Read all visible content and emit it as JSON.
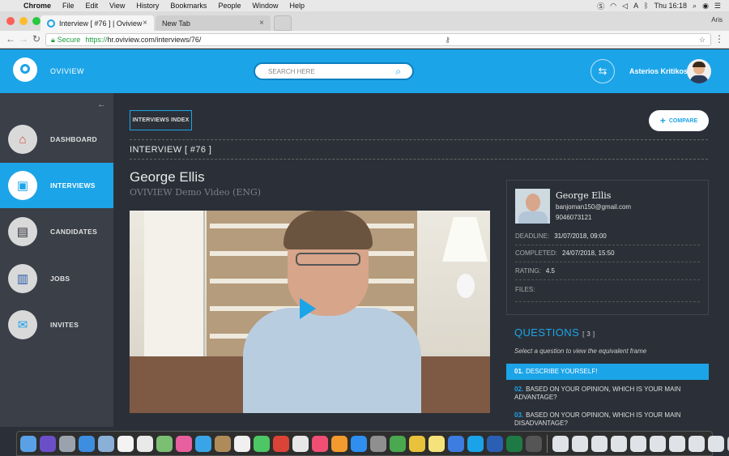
{
  "menubar": {
    "app": "Chrome",
    "items": [
      "File",
      "Edit",
      "View",
      "History",
      "Bookmarks",
      "People",
      "Window",
      "Help"
    ],
    "clock": "Thu 16:18",
    "input_source": "A"
  },
  "browser": {
    "tabs": [
      {
        "label": "Interview [ #76 ] | Oviview"
      },
      {
        "label": "New Tab"
      }
    ],
    "profile": "Aris",
    "secure_label": "Secure",
    "url_scheme": "https://",
    "url_rest": "hr.oviview.com/interviews/76/"
  },
  "header": {
    "brand": "OVIVIEW",
    "search_placeholder": "SEARCH HERE",
    "user_name": "Asterios Kritikos"
  },
  "sidebar": {
    "items": [
      {
        "label": "DASHBOARD",
        "icon": "house-icon"
      },
      {
        "label": "INTERVIEWS",
        "icon": "monitor-play-icon"
      },
      {
        "label": "CANDIDATES",
        "icon": "id-card-icon"
      },
      {
        "label": "JOBS",
        "icon": "chart-bars-icon"
      },
      {
        "label": "INVITES",
        "icon": "envelope-icon"
      }
    ],
    "active": "INTERVIEWS"
  },
  "main": {
    "index_button": "INTERVIEWS INDEX",
    "compare_button": "COMPARE",
    "interview_title": "INTERVIEW [ #76 ]",
    "candidate_name": "George Ellis",
    "video_title": "OVIVIEW Demo Video (ENG)"
  },
  "candidate_card": {
    "name": "George Ellis",
    "email": "banjoman150@gmail.com",
    "phone": "9046073121",
    "deadline_label": "DEADLINE:",
    "deadline_value": "31/07/2018, 09:00",
    "completed_label": "COMPLETED:",
    "completed_value": "24/07/2018, 15:50",
    "rating_label": "RATING:",
    "rating_value": "4.5",
    "files_label": "FILES:"
  },
  "questions": {
    "title": "QUESTIONS",
    "count": "[ 3 ]",
    "hint": "Select a question to view the equivalent frame",
    "items": [
      {
        "num": "01.",
        "text": "DESCRIBE YOURSELF!"
      },
      {
        "num": "02.",
        "text": "BASED ON YOUR OPINION, WHICH IS YOUR MAIN ADVANTAGE?"
      },
      {
        "num": "03.",
        "text": "BASED ON YOUR OPINION, WHICH IS YOUR MAIN DISADVANTAGE?"
      }
    ]
  },
  "colors": {
    "accent": "#1ca4e8",
    "sidebar": "#3a3f48",
    "main_bg": "#2b3038"
  }
}
